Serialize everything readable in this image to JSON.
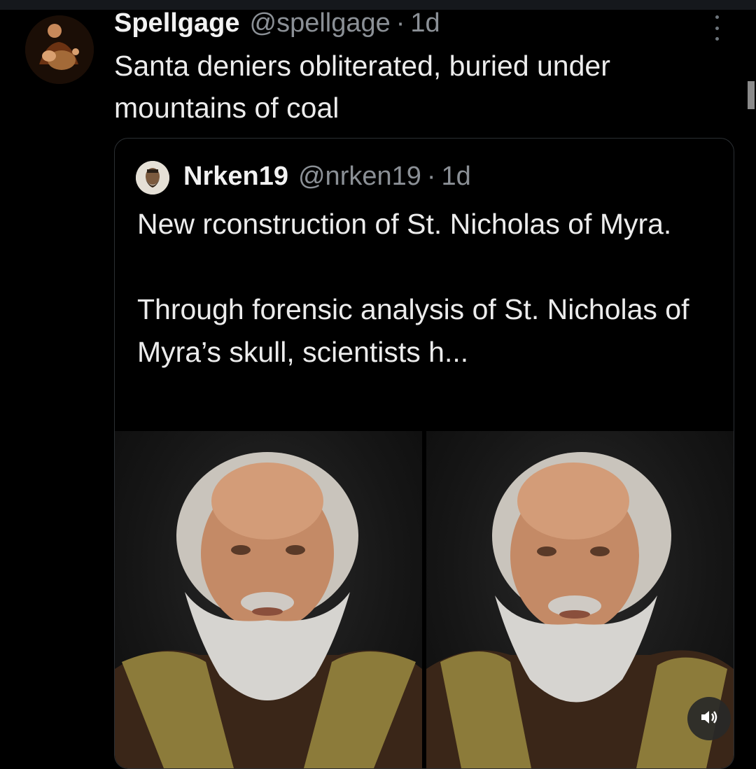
{
  "tweet": {
    "display_name": "Spellgage",
    "handle": "@spellgage",
    "separator": "·",
    "time": "1d",
    "text_line1": "Santa deniers obliterated, buried under",
    "text_line2": "mountains of coal"
  },
  "quote": {
    "display_name": "Nrken19",
    "handle": "@nrken19",
    "separator": "·",
    "time": "1d",
    "paragraph1": "New rconstruction of St. Nicholas of Myra.",
    "paragraph2": "Through forensic analysis of St. Nicholas of Myra’s skull, scientists h..."
  },
  "icons": {
    "more": "more-vertical-icon",
    "volume": "volume-icon"
  },
  "colors": {
    "background": "#000000",
    "text": "#e7e9ea",
    "secondary_text": "#8b9096",
    "card_border": "#2b2f33"
  }
}
